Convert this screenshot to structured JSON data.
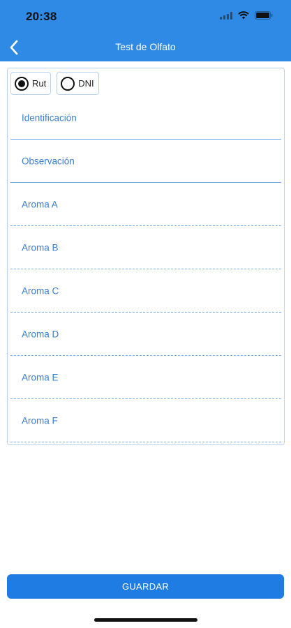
{
  "status_bar": {
    "time": "20:38"
  },
  "header": {
    "title": "Test de Olfato"
  },
  "id_type": {
    "options": [
      "Rut",
      "DNI"
    ],
    "selected": "Rut"
  },
  "fields": [
    {
      "label": "Identificación"
    },
    {
      "label": "Observación"
    },
    {
      "label": "Aroma A"
    },
    {
      "label": "Aroma B"
    },
    {
      "label": "Aroma C"
    },
    {
      "label": "Aroma D"
    },
    {
      "label": "Aroma E"
    },
    {
      "label": "Aroma F"
    }
  ],
  "save_button": {
    "label": "GUARDAR"
  },
  "colors": {
    "header": "#2f8ae5",
    "label": "#3a7fd0",
    "button": "#1f7ce3"
  }
}
